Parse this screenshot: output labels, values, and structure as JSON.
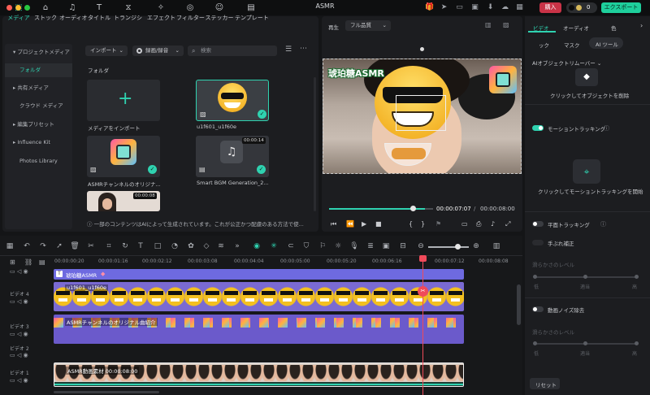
{
  "window": {
    "title": "ASMR"
  },
  "topbar": {
    "buy_label": "購入",
    "toggle_count": "0",
    "export_label": "エクスポート"
  },
  "media_tabs": [
    {
      "label": "メディア",
      "icon": "media-icon"
    },
    {
      "label": "ストック",
      "icon": "stock-icon"
    },
    {
      "label": "オーディオ",
      "icon": "audio-icon"
    },
    {
      "label": "タイトル",
      "icon": "title-icon"
    },
    {
      "label": "トランジション",
      "icon": "transition-icon"
    },
    {
      "label": "エフェクト",
      "icon": "effect-icon"
    },
    {
      "label": "フィルター",
      "icon": "filter-icon"
    },
    {
      "label": "ステッカー",
      "icon": "sticker-icon"
    },
    {
      "label": "テンプレート",
      "icon": "template-icon"
    }
  ],
  "sidebar": [
    {
      "label": "プロジェクトメディア",
      "arrow": "▾"
    },
    {
      "label": "フォルダ",
      "arrow": ""
    },
    {
      "label": "共有メディア",
      "arrow": "▸"
    },
    {
      "label": "クラウド メディア",
      "arrow": ""
    },
    {
      "label": "編集プリセット",
      "arrow": "▸"
    },
    {
      "label": "Influence Kit",
      "arrow": "▸"
    },
    {
      "label": "Photos Library",
      "arrow": ""
    }
  ],
  "media_toolbar": {
    "import_label": "インポート",
    "record_label": "録画/録音",
    "search_placeholder": "検索"
  },
  "folder_label": "フォルダ",
  "media_items": [
    {
      "caption": "メディアをインポート"
    },
    {
      "caption": "u1f601_u1f60e"
    },
    {
      "caption": "ASMRチャンネルのオリジナ..."
    },
    {
      "caption": "Smart BGM Generation_2...",
      "duration": "00:00:14"
    },
    {
      "caption": "",
      "duration": "00:00:08"
    }
  ],
  "ai_notice": "一部のコンテンツはAIによって生成されています。これが公正かつ配慮のある方法で使...",
  "preview": {
    "play_label": "再生",
    "quality": "フル品質",
    "overlay_title": "琥珀糖ASMR",
    "current_time": "00:00:07:07",
    "total_time": "00:00:08:00",
    "progress": 0.89
  },
  "right_panel": {
    "tabs": [
      "ビデオ",
      "オーディオ",
      "色"
    ],
    "subtabs": [
      "ック",
      "マスク",
      "AI ツール"
    ],
    "remover_title": "AIオブジェクトリムーバー",
    "remover_action": "クリックしてオブジェクトを削除",
    "motion_tracking": "モーショントラッキング",
    "motion_action": "クリックしてモーショントラッキングを開始",
    "planar_tracking": "平面トラッキング",
    "shake_fix": "手ぶれ補正",
    "smooth_level": "滑らかさのレベル",
    "noise_reduction": "動画ノイズ除去",
    "reset_label": "リセット",
    "level_marks": [
      "低",
      "適当",
      "高"
    ]
  },
  "timeline": {
    "ruler": [
      "00:00:00:20",
      "00:00:01:16",
      "00:00:02:12",
      "00:00:03:08",
      "00:00:04:04",
      "00:00:05:00",
      "00:00:05:20",
      "00:00:06:16",
      "00:00:07:12",
      "00:00:08:08"
    ],
    "tracks": [
      {
        "name": "",
        "clip": "琥珀糖ASMR"
      },
      {
        "name": "ビデオ 4",
        "clip": "u1f601_u1f60e"
      },
      {
        "name": "ビデオ 3",
        "clip": "ASMRチャンネルのオリジナル曲紹介"
      },
      {
        "name": "ビデオ 2",
        "clip": ""
      },
      {
        "name": "ビデオ 1",
        "clip": "ASMR動画素材  00:00:08:00"
      }
    ],
    "playhead_ratio": 0.87
  },
  "colors": {
    "accent": "#2fd2b0",
    "clip_purple": "#6b5acb",
    "buy": "#c93347",
    "export": "#1ecf9c"
  }
}
